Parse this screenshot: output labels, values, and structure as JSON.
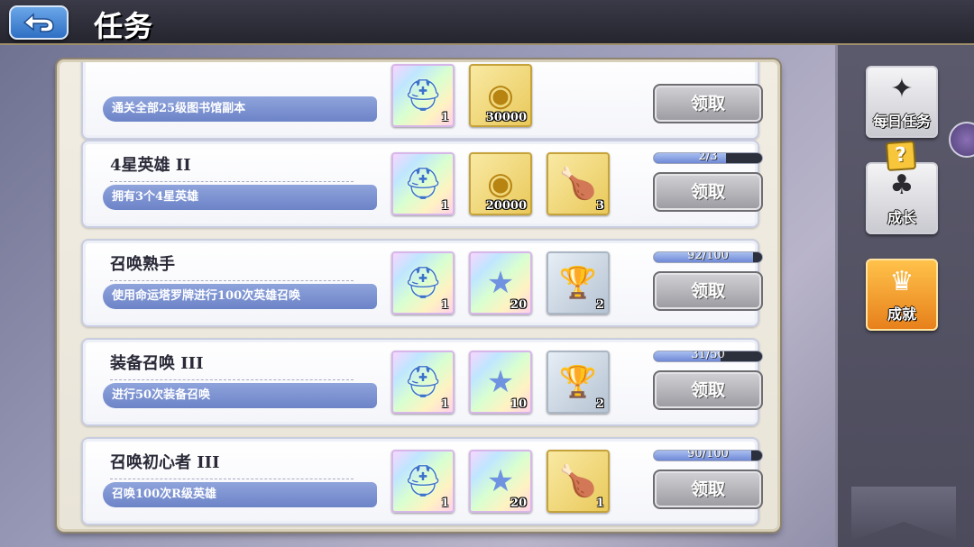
{
  "header": {
    "title": "任务",
    "back_icon": "back-arrow-icon"
  },
  "tasks": [
    {
      "title": "",
      "desc": "通关全部25级图书馆副本",
      "progress_text": "",
      "progress": null,
      "claim": "领取",
      "rewards": [
        {
          "icon": "helmet-icon",
          "style": "rainbow",
          "count": "1"
        },
        {
          "icon": "gold-coin-icon",
          "style": "gold",
          "count": "30000"
        }
      ]
    },
    {
      "title": "4星英雄 II",
      "desc": "拥有3个4星英雄",
      "progress_text": "2/3",
      "progress": 0.667,
      "claim": "领取",
      "rewards": [
        {
          "icon": "helmet-icon",
          "style": "rainbow",
          "count": "1"
        },
        {
          "icon": "gold-coin-icon",
          "style": "gold",
          "count": "20000"
        },
        {
          "icon": "roast-chicken-icon",
          "style": "gold",
          "count": "3"
        }
      ]
    },
    {
      "title": "召唤熟手",
      "desc": "使用命运塔罗牌进行100次英雄召唤",
      "progress_text": "92/100",
      "progress": 0.92,
      "claim": "领取",
      "rewards": [
        {
          "icon": "helmet-icon",
          "style": "rainbow",
          "count": "1"
        },
        {
          "icon": "crystal-star-icon",
          "style": "rainbow",
          "count": "20"
        },
        {
          "icon": "silver-card-icon",
          "style": "silver",
          "count": "2"
        }
      ]
    },
    {
      "title": "装备召唤 III",
      "desc": "进行50次装备召唤",
      "progress_text": "31/50",
      "progress": 0.62,
      "claim": "领取",
      "rewards": [
        {
          "icon": "helmet-icon",
          "style": "rainbow",
          "count": "1"
        },
        {
          "icon": "crystal-star-icon",
          "style": "rainbow",
          "count": "10"
        },
        {
          "icon": "silver-card-icon",
          "style": "silver",
          "count": "2"
        }
      ]
    },
    {
      "title": "召唤初心者 III",
      "desc": "召唤100次R级英雄",
      "progress_text": "90/100",
      "progress": 0.9,
      "claim": "领取",
      "rewards": [
        {
          "icon": "helmet-icon",
          "style": "rainbow",
          "count": "1"
        },
        {
          "icon": "crystal-star-icon",
          "style": "rainbow",
          "count": "20"
        },
        {
          "icon": "roast-chicken-icon",
          "style": "gold",
          "count": "1"
        }
      ]
    }
  ],
  "side_tabs": [
    {
      "label": "每日任务",
      "icon": "daily-quest-icon",
      "active": false
    },
    {
      "label": "成长",
      "icon": "growth-icon",
      "active": false,
      "badge": "?"
    },
    {
      "label": "成就",
      "icon": "achievement-icon",
      "active": true
    }
  ],
  "colors": {
    "accent": "#6c83c7",
    "active_tab": "#f0a030",
    "claim_disabled": "#9a9aa0"
  }
}
